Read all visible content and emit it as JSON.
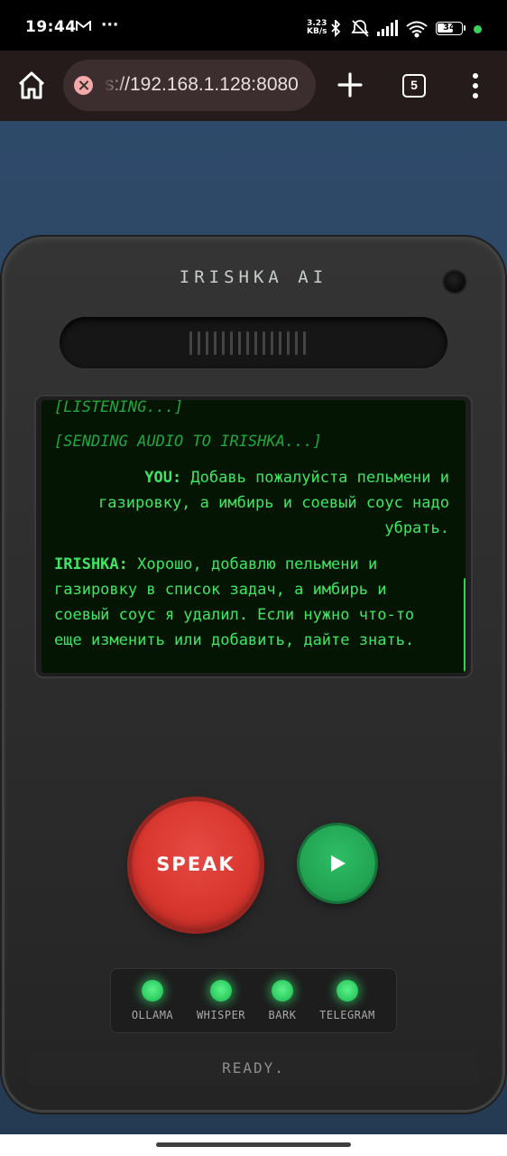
{
  "statusbar": {
    "time": "19:44",
    "dots": "···",
    "speed_value": "3.23",
    "speed_unit": "KB/s",
    "battery": "34"
  },
  "browser": {
    "url": "s://192.168.1.128:8080",
    "tab_count": "5"
  },
  "device": {
    "title": "IRISHKA AI"
  },
  "terminal": {
    "system_lines": [
      "[LISTENING...]",
      "[SENDING AUDIO TO IRISHKA...]"
    ],
    "user": {
      "label": "YOU:",
      "line1": " Добавь пожалуйста пельмени и",
      "line2": "газировку, а имбирь и соевый соус надо",
      "line3": "убрать."
    },
    "bot": {
      "label": "IRISHKA:",
      "line1": " Хорошо, добавлю пельмени и",
      "line2": "газировку в список задач, а имбирь и",
      "line3": "соевый соус я удалил. Если нужно что-то",
      "line4": "еще изменить или добавить, дайте знать."
    }
  },
  "controls": {
    "speak_label": "SPEAK",
    "play_icon": "play-icon"
  },
  "indicators": [
    {
      "label": "OLLAMA",
      "color": "#35d368"
    },
    {
      "label": "WHISPER",
      "color": "#35d368"
    },
    {
      "label": "BARK",
      "color": "#35d368"
    },
    {
      "label": "TELEGRAM",
      "color": "#35d368"
    }
  ],
  "status": {
    "text": "READY."
  },
  "colors": {
    "terminal_text": "#3fe760",
    "terminal_bg": "#041504",
    "speak_red": "#d8372f",
    "play_green": "#22a653"
  }
}
